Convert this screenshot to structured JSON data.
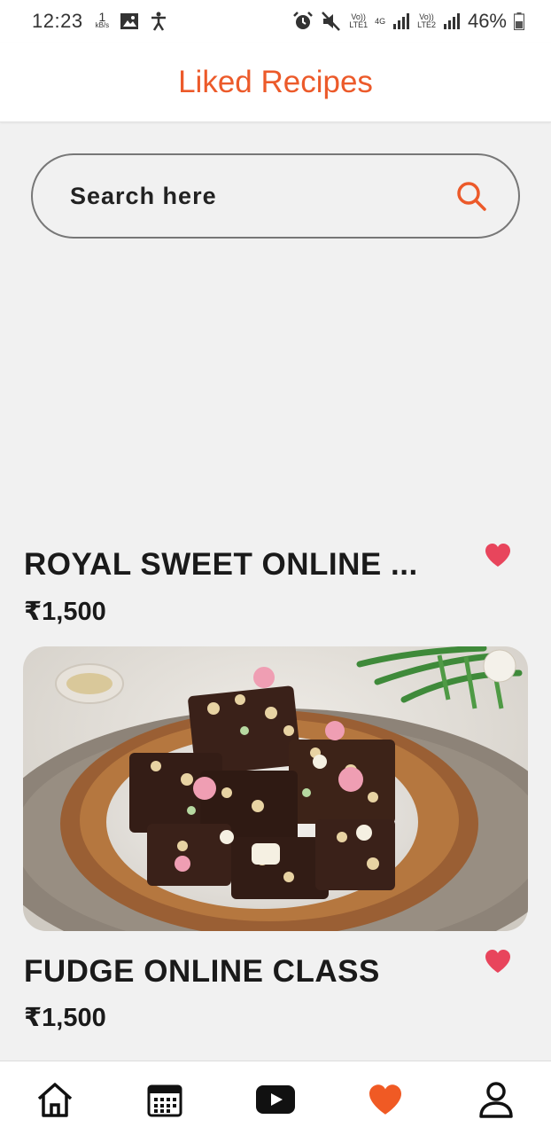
{
  "status_bar": {
    "time": "12:23",
    "net_speed_value": "1",
    "net_speed_unit": "kB/s",
    "sim1_label_top": "Vo))",
    "sim1_label_bottom": "LTE1",
    "network_type": "4G",
    "sim2_label_top": "Vo))",
    "sim2_label_bottom": "LTE2",
    "battery": "46%",
    "icons": [
      "gallery-icon",
      "accessibility-icon",
      "alarm-icon",
      "mute-icon",
      "signal-icon",
      "battery-icon"
    ]
  },
  "header": {
    "title": "Liked Recipes"
  },
  "search": {
    "placeholder": "Search here"
  },
  "recipes": [
    {
      "title": "ROYAL SWEET ONLINE ...",
      "price": "₹1,500",
      "liked": true
    },
    {
      "title": "FUDGE ONLINE CLASS",
      "price": "₹1,500",
      "liked": true,
      "image": "chocolate-fudge-photo"
    }
  ],
  "bottom_nav": {
    "items": [
      "home-icon",
      "calendar-icon",
      "video-icon",
      "heart-icon",
      "profile-icon"
    ],
    "active": "heart-icon"
  },
  "colors": {
    "accent": "#ec5a2a",
    "heart": "#e8455c",
    "background": "#f1f1f1"
  }
}
